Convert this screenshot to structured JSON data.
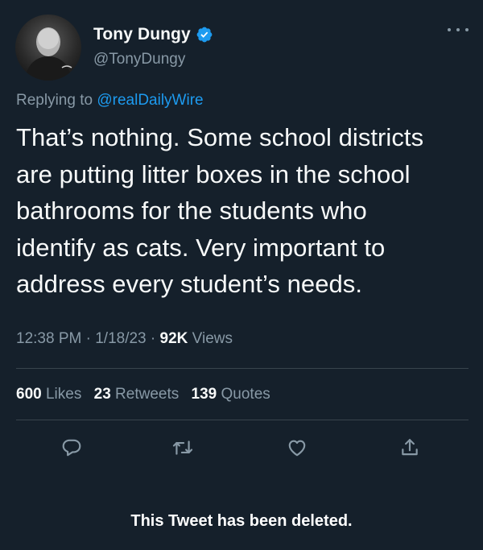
{
  "colors": {
    "background": "#15202b",
    "text_primary": "#f7f9f9",
    "text_secondary": "#8899a6",
    "accent": "#1d9bf0",
    "divider": "#38444d"
  },
  "author": {
    "display_name": "Tony Dungy",
    "handle": "@TonyDungy",
    "verified_icon": "verified-badge-icon",
    "avatar": "profile-photo"
  },
  "reply": {
    "prefix": "Replying to",
    "handle": "@realDailyWire"
  },
  "tweet": {
    "lines": [
      "That’s nothing. Some school districts",
      "are putting litter boxes in the school",
      "bathrooms for the students who",
      "identify as cats.  Very important to",
      "address every student’s needs."
    ]
  },
  "meta": {
    "time": "12:38 PM",
    "separator": "·",
    "date": "1/18/23",
    "views_count": "92K",
    "views_label": "Views"
  },
  "stats": {
    "likes_count": "600",
    "likes_label": "Likes",
    "retweets_count": "23",
    "retweets_label": "Retweets",
    "quotes_count": "139",
    "quotes_label": "Quotes"
  },
  "actions": [
    "reply-icon",
    "retweet-icon",
    "like-icon",
    "share-icon"
  ],
  "notice": "This Tweet has been deleted."
}
